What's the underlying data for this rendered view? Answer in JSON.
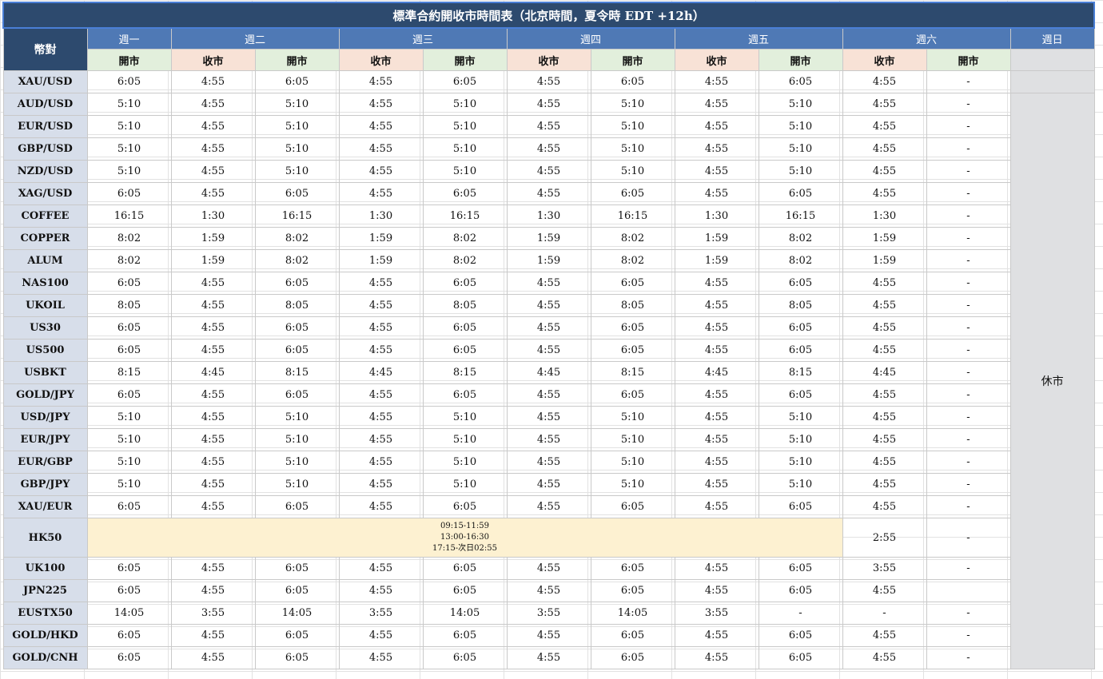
{
  "title": "標準合約開收市時間表（北京時間，夏令時 EDT +12h）",
  "pair_header": "幣對",
  "days": [
    "週一",
    "週二",
    "週三",
    "週四",
    "週五",
    "週六",
    "週日"
  ],
  "open_label": "開市",
  "close_label": "收市",
  "sunday_text": "休市",
  "sub_headers": [
    "開市",
    "收市",
    "開市",
    "收市",
    "開市",
    "收市",
    "開市",
    "收市",
    "開市",
    "收市",
    "開市"
  ],
  "rows": [
    {
      "pair": "XAU/USD",
      "cells": [
        "6:05",
        "4:55",
        "6:05",
        "4:55",
        "6:05",
        "4:55",
        "6:05",
        "4:55",
        "6:05",
        "4:55",
        "-"
      ]
    },
    {
      "pair": "AUD/USD",
      "cells": [
        "5:10",
        "4:55",
        "5:10",
        "4:55",
        "5:10",
        "4:55",
        "5:10",
        "4:55",
        "5:10",
        "4:55",
        "-"
      ]
    },
    {
      "pair": "EUR/USD",
      "cells": [
        "5:10",
        "4:55",
        "5:10",
        "4:55",
        "5:10",
        "4:55",
        "5:10",
        "4:55",
        "5:10",
        "4:55",
        "-"
      ]
    },
    {
      "pair": "GBP/USD",
      "cells": [
        "5:10",
        "4:55",
        "5:10",
        "4:55",
        "5:10",
        "4:55",
        "5:10",
        "4:55",
        "5:10",
        "4:55",
        "-"
      ]
    },
    {
      "pair": "NZD/USD",
      "cells": [
        "5:10",
        "4:55",
        "5:10",
        "4:55",
        "5:10",
        "4:55",
        "5:10",
        "4:55",
        "5:10",
        "4:55",
        "-"
      ]
    },
    {
      "pair": "XAG/USD",
      "cells": [
        "6:05",
        "4:55",
        "6:05",
        "4:55",
        "6:05",
        "4:55",
        "6:05",
        "4:55",
        "6:05",
        "4:55",
        "-"
      ]
    },
    {
      "pair": "COFFEE",
      "cells": [
        "16:15",
        "1:30",
        "16:15",
        "1:30",
        "16:15",
        "1:30",
        "16:15",
        "1:30",
        "16:15",
        "1:30",
        "-"
      ]
    },
    {
      "pair": "COPPER",
      "cells": [
        "8:02",
        "1:59",
        "8:02",
        "1:59",
        "8:02",
        "1:59",
        "8:02",
        "1:59",
        "8:02",
        "1:59",
        "-"
      ]
    },
    {
      "pair": "ALUM",
      "cells": [
        "8:02",
        "1:59",
        "8:02",
        "1:59",
        "8:02",
        "1:59",
        "8:02",
        "1:59",
        "8:02",
        "1:59",
        "-"
      ]
    },
    {
      "pair": "NAS100",
      "cells": [
        "6:05",
        "4:55",
        "6:05",
        "4:55",
        "6:05",
        "4:55",
        "6:05",
        "4:55",
        "6:05",
        "4:55",
        "-"
      ]
    },
    {
      "pair": "UKOIL",
      "cells": [
        "8:05",
        "4:55",
        "8:05",
        "4:55",
        "8:05",
        "4:55",
        "8:05",
        "4:55",
        "8:05",
        "4:55",
        "-"
      ]
    },
    {
      "pair": "US30",
      "cells": [
        "6:05",
        "4:55",
        "6:05",
        "4:55",
        "6:05",
        "4:55",
        "6:05",
        "4:55",
        "6:05",
        "4:55",
        "-"
      ]
    },
    {
      "pair": "US500",
      "cells": [
        "6:05",
        "4:55",
        "6:05",
        "4:55",
        "6:05",
        "4:55",
        "6:05",
        "4:55",
        "6:05",
        "4:55",
        "-"
      ]
    },
    {
      "pair": "USBKT",
      "cells": [
        "8:15",
        "4:45",
        "8:15",
        "4:45",
        "8:15",
        "4:45",
        "8:15",
        "4:45",
        "8:15",
        "4:45",
        "-"
      ]
    },
    {
      "pair": "GOLD/JPY",
      "cells": [
        "6:05",
        "4:55",
        "6:05",
        "4:55",
        "6:05",
        "4:55",
        "6:05",
        "4:55",
        "6:05",
        "4:55",
        "-"
      ]
    },
    {
      "pair": "USD/JPY",
      "cells": [
        "5:10",
        "4:55",
        "5:10",
        "4:55",
        "5:10",
        "4:55",
        "5:10",
        "4:55",
        "5:10",
        "4:55",
        "-"
      ]
    },
    {
      "pair": "EUR/JPY",
      "cells": [
        "5:10",
        "4:55",
        "5:10",
        "4:55",
        "5:10",
        "4:55",
        "5:10",
        "4:55",
        "5:10",
        "4:55",
        "-"
      ]
    },
    {
      "pair": "EUR/GBP",
      "cells": [
        "5:10",
        "4:55",
        "5:10",
        "4:55",
        "5:10",
        "4:55",
        "5:10",
        "4:55",
        "5:10",
        "4:55",
        "-"
      ]
    },
    {
      "pair": "GBP/JPY",
      "cells": [
        "5:10",
        "4:55",
        "5:10",
        "4:55",
        "5:10",
        "4:55",
        "5:10",
        "4:55",
        "5:10",
        "4:55",
        "-"
      ]
    },
    {
      "pair": "XAU/EUR",
      "cells": [
        "6:05",
        "4:55",
        "6:05",
        "4:55",
        "6:05",
        "4:55",
        "6:05",
        "4:55",
        "6:05",
        "4:55",
        "-"
      ]
    }
  ],
  "hk50": {
    "pair": "HK50",
    "sessions": [
      "09:15-11:59",
      "13:00-16:30",
      "17:15-次日02:55"
    ],
    "sat_close": "2:55",
    "sat_open": "-"
  },
  "rows_after": [
    {
      "pair": "UK100",
      "cells": [
        "6:05",
        "4:55",
        "6:05",
        "4:55",
        "6:05",
        "4:55",
        "6:05",
        "4:55",
        "6:05",
        "3:55",
        "-"
      ]
    },
    {
      "pair": "JPN225",
      "cells": [
        "6:05",
        "4:55",
        "6:05",
        "4:55",
        "6:05",
        "4:55",
        "6:05",
        "4:55",
        "6:05",
        "4:55",
        ""
      ]
    },
    {
      "pair": "EUSTX50",
      "cells": [
        "14:05",
        "3:55",
        "14:05",
        "3:55",
        "14:05",
        "3:55",
        "14:05",
        "3:55",
        "-",
        "-",
        "-"
      ]
    },
    {
      "pair": "GOLD/HKD",
      "cells": [
        "6:05",
        "4:55",
        "6:05",
        "4:55",
        "6:05",
        "4:55",
        "6:05",
        "4:55",
        "6:05",
        "4:55",
        "-"
      ]
    },
    {
      "pair": "GOLD/CNH",
      "cells": [
        "6:05",
        "4:55",
        "6:05",
        "4:55",
        "6:05",
        "4:55",
        "6:05",
        "4:55",
        "6:05",
        "4:55",
        "-"
      ]
    }
  ],
  "colors": {
    "title_bg": "#2d4a6e",
    "day_header_bg": "#4f79b5",
    "open_bg": "#e2efdc",
    "close_bg": "#f8e2d6",
    "pair_bg": "#d7deea",
    "sunday_bg": "#dfe0e2",
    "hk_bg": "#fdf1d1"
  }
}
